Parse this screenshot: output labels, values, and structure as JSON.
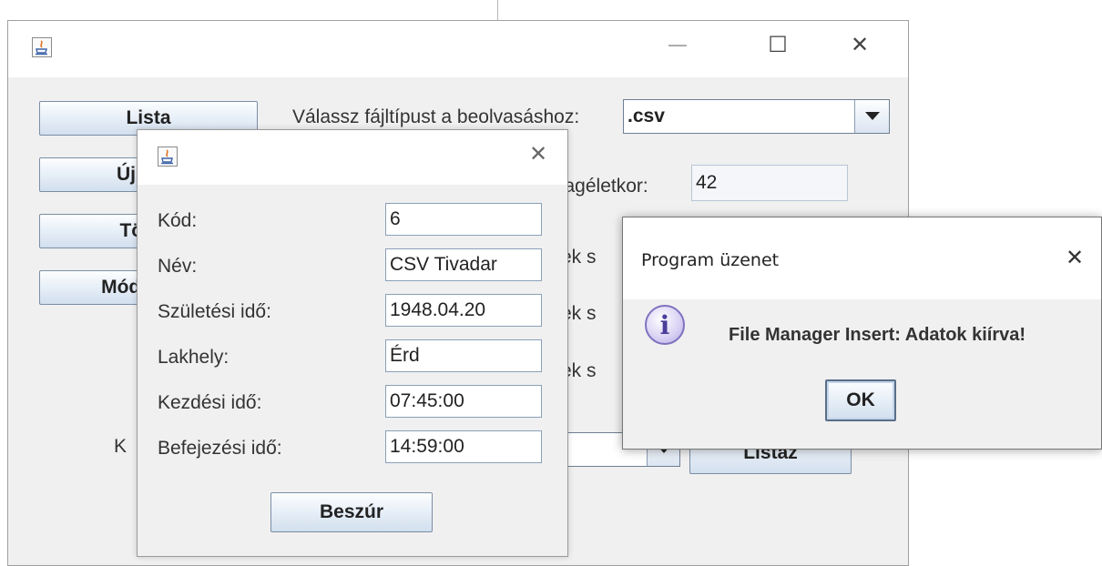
{
  "main_window": {
    "controls": {
      "minimize": "—",
      "maximize": "☐",
      "close": "✕"
    },
    "buttons": {
      "list": "Lista",
      "new": "Új adat",
      "delete": "Törlés",
      "modify": "Módosítás"
    },
    "filetype_label": "Válassz fájltípust a beolvasáshoz:",
    "filetype_value": ".csv",
    "avg_age_label": "Átlagéletkor:",
    "avg_age_value": "42",
    "partial_label_1": "rek s",
    "partial_label_2": "rek s",
    "partial_label_3": "rek s",
    "partial_left_label": "K",
    "list_button": "Listáz"
  },
  "insert_dialog": {
    "close": "✕",
    "fields": [
      {
        "label": "Kód:",
        "value": "6"
      },
      {
        "label": "Név:",
        "value": "CSV Tivadar"
      },
      {
        "label": "Születési idő:",
        "value": "1948.04.20"
      },
      {
        "label": "Lakhely:",
        "value": "Érd"
      },
      {
        "label": "Kezdési idő:",
        "value": "07:45:00"
      },
      {
        "label": "Befejezési idő:",
        "value": "14:59:00"
      }
    ],
    "insert_button": "Beszúr"
  },
  "message_dialog": {
    "title": "Program üzenet",
    "close": "✕",
    "icon": "info-icon",
    "message": "File Manager Insert: Adatok kiírva!",
    "ok_button": "OK"
  }
}
